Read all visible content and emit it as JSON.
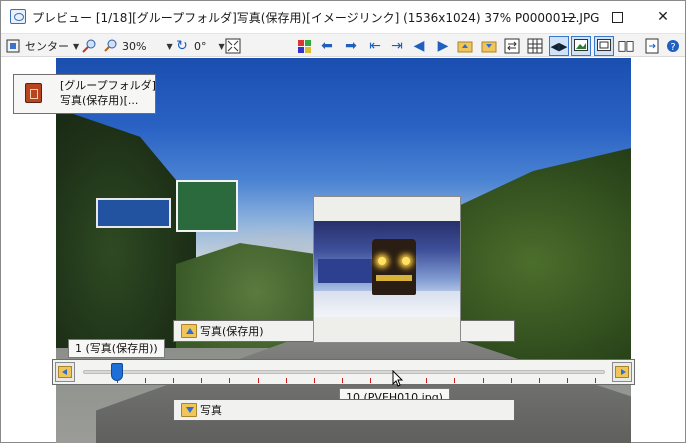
{
  "window": {
    "title": "プレビュー [1/18][グループフォルダ]写真(保存用)[イメージリンク] (1536x1024) 37% P0000012.JPG",
    "minimize_glyph": "",
    "close_glyph": "✕"
  },
  "toolbar": {
    "align_label": "センター",
    "zoom_label": "30%",
    "rotate_label": "0°"
  },
  "folder_popup": {
    "line1": "[グループフォルダ]",
    "line2": "写真(保存用)[..."
  },
  "folder_up_label": "写真(保存用)",
  "folder_down_label": "写真",
  "slider": {
    "position_label": "1 (写真(保存用))",
    "hover_label": "10 (PVEH010.jpg)",
    "tick_count": 18,
    "current": 1
  },
  "colors": {
    "accent": "#1f6fd6",
    "tick": "#d01818"
  }
}
